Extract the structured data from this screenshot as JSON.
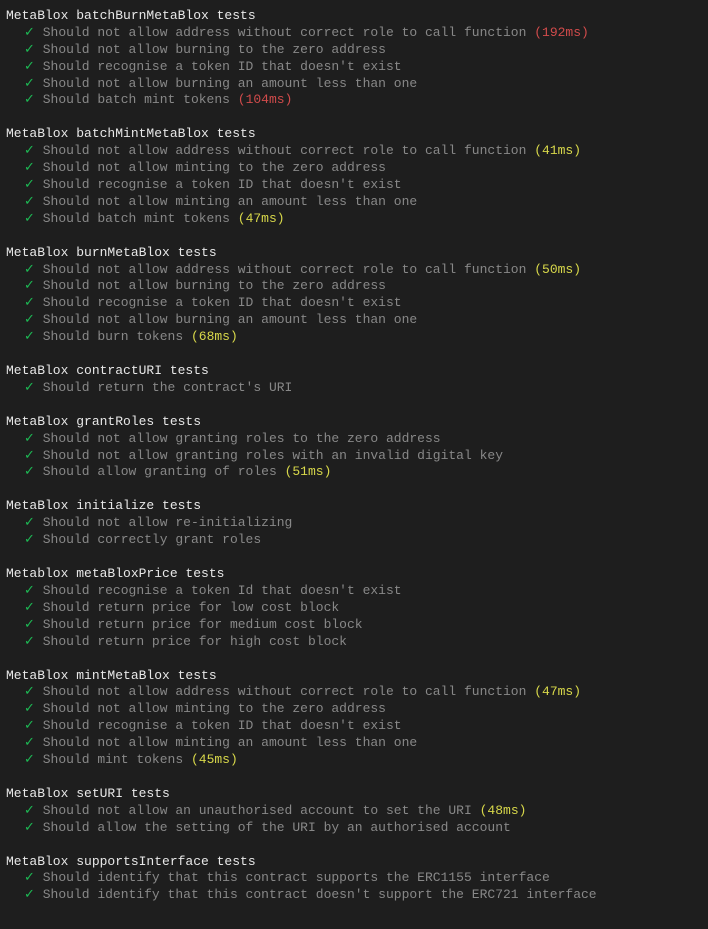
{
  "checkmark": "✓",
  "suites": [
    {
      "name": "MetaBlox batchBurnMetaBlox tests",
      "tests": [
        {
          "desc": "Should not allow address without correct role to call function",
          "timing": "(192ms)",
          "timingClass": "red"
        },
        {
          "desc": "Should not allow burning to the zero address"
        },
        {
          "desc": "Should recognise a token ID that doesn't exist"
        },
        {
          "desc": "Should not allow burning an amount less than one"
        },
        {
          "desc": "Should batch mint tokens",
          "timing": "(104ms)",
          "timingClass": "red"
        }
      ]
    },
    {
      "name": "MetaBlox batchMintMetaBlox tests",
      "tests": [
        {
          "desc": "Should not allow address without correct role to call function",
          "timing": "(41ms)",
          "timingClass": "yellow"
        },
        {
          "desc": "Should not allow minting to the zero address"
        },
        {
          "desc": "Should recognise a token ID that doesn't exist"
        },
        {
          "desc": "Should not allow minting an amount less than one"
        },
        {
          "desc": "Should batch mint tokens",
          "timing": "(47ms)",
          "timingClass": "yellow"
        }
      ]
    },
    {
      "name": "MetaBlox burnMetaBlox tests",
      "tests": [
        {
          "desc": "Should not allow address without correct role to call function",
          "timing": "(50ms)",
          "timingClass": "yellow"
        },
        {
          "desc": "Should not allow burning to the zero address"
        },
        {
          "desc": "Should recognise a token ID that doesn't exist"
        },
        {
          "desc": "Should not allow burning an amount less than one"
        },
        {
          "desc": "Should burn tokens",
          "timing": "(68ms)",
          "timingClass": "yellow"
        }
      ]
    },
    {
      "name": "MetaBlox contractURI tests",
      "tests": [
        {
          "desc": "Should return the contract's URI"
        }
      ]
    },
    {
      "name": "MetaBlox grantRoles tests",
      "tests": [
        {
          "desc": "Should not allow granting roles to the zero address"
        },
        {
          "desc": "Should not allow granting roles with an invalid digital key"
        },
        {
          "desc": "Should allow granting of roles",
          "timing": "(51ms)",
          "timingClass": "yellow"
        }
      ]
    },
    {
      "name": "MetaBlox initialize tests",
      "tests": [
        {
          "desc": "Should not allow re-initializing"
        },
        {
          "desc": "Should correctly grant roles"
        }
      ]
    },
    {
      "name": "Metablox metaBloxPrice tests",
      "tests": [
        {
          "desc": "Should recognise a token Id that doesn't exist"
        },
        {
          "desc": "Should return price for low cost block"
        },
        {
          "desc": "Should return price for medium cost block"
        },
        {
          "desc": "Should return price for high cost block"
        }
      ]
    },
    {
      "name": "MetaBlox mintMetaBlox tests",
      "tests": [
        {
          "desc": "Should not allow address without correct role to call function",
          "timing": "(47ms)",
          "timingClass": "yellow"
        },
        {
          "desc": "Should not allow minting to the zero address"
        },
        {
          "desc": "Should recognise a token ID that doesn't exist"
        },
        {
          "desc": "Should not allow minting an amount less than one"
        },
        {
          "desc": "Should mint tokens",
          "timing": "(45ms)",
          "timingClass": "yellow"
        }
      ]
    },
    {
      "name": "MetaBlox setURI tests",
      "tests": [
        {
          "desc": "Should not allow an unauthorised account to set the URI",
          "timing": "(48ms)",
          "timingClass": "yellow"
        },
        {
          "desc": "Should allow the setting of the URI by an authorised account"
        }
      ]
    },
    {
      "name": "MetaBlox supportsInterface tests",
      "tests": [
        {
          "desc": "Should identify that this contract supports the ERC1155 interface"
        },
        {
          "desc": "Should identify that this contract doesn't support the ERC721 interface"
        }
      ]
    }
  ]
}
